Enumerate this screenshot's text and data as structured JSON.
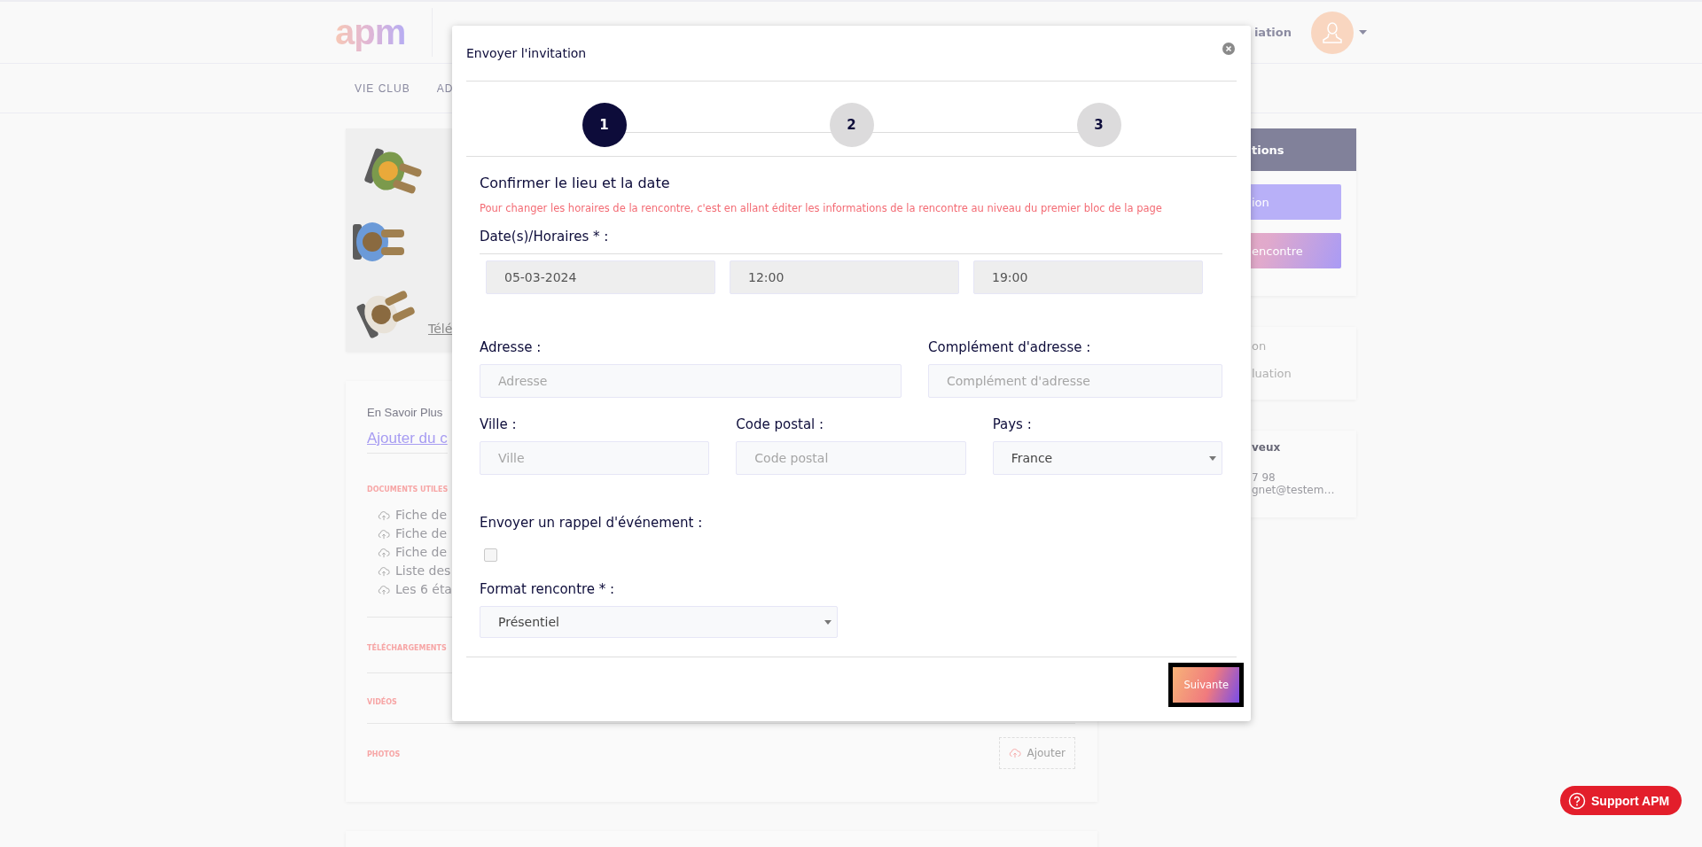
{
  "header": {
    "logo": "apm",
    "nav_fragment": "iation"
  },
  "nav": {
    "items": [
      {
        "label": "VIE CLUB"
      },
      {
        "label": "AD"
      }
    ]
  },
  "left": {
    "media_card": {
      "link": "Télé"
    },
    "info_card": {
      "heading": "En Savoir Plus",
      "add_link": "Ajouter du c",
      "documents_label": "DOCUMENTS UTILES",
      "documents": [
        {
          "label": "Fiche de"
        },
        {
          "label": "Fiche de"
        },
        {
          "label": "Fiche de"
        },
        {
          "label": "Liste des"
        },
        {
          "label": "Les 6 éta"
        }
      ],
      "downloads_label": "TÉLÉCHARGEMENTS",
      "videos_label": "VIDÉOS",
      "photos_label": "PHOTOS",
      "add_button": "Ajouter"
    }
  },
  "right": {
    "actions_card": {
      "title": "tions",
      "buttons": [
        {
          "label": "ion",
          "kind": "plain"
        },
        {
          "label": "encontre",
          "kind": "gradient"
        }
      ]
    },
    "links_card": {
      "items": [
        "on",
        "luation"
      ]
    },
    "contact_card": {
      "name": "veux",
      "phone": "7 98",
      "email": "gnet@testem…"
    }
  },
  "modal": {
    "title": "Envoyer l'invitation",
    "steps": [
      {
        "label": "1",
        "selected": true
      },
      {
        "label": "2",
        "selected": false
      },
      {
        "label": "3",
        "selected": false
      }
    ],
    "section_title": "Confirmer le lieu et la date",
    "note": "Pour changer les horaires de la rencontre, c'est en allant éditer les informations de la rencontre au niveau du premier bloc de la page",
    "schedule": {
      "label": "Date(s)/Horaires * :",
      "fields": [
        {
          "value": "05-03-2024",
          "disabled": true
        },
        {
          "value": "12:00",
          "disabled": true
        },
        {
          "value": "19:00",
          "disabled": true
        }
      ]
    },
    "address_rows": [
      {
        "fields": [
          {
            "label": "Adresse :",
            "kind": "input",
            "placeholder": "Adresse"
          },
          {
            "label": "Complément d'adresse :",
            "kind": "input",
            "placeholder": "Complément d'adresse"
          }
        ]
      },
      {
        "fields": [
          {
            "label": "Ville :",
            "kind": "input",
            "placeholder": "Ville"
          },
          {
            "label": "Code postal :",
            "kind": "input",
            "placeholder": "Code postal"
          },
          {
            "label": "Pays :",
            "kind": "select",
            "value": "France"
          }
        ]
      }
    ],
    "reminder": {
      "label": "Envoyer un rappel d'événement :",
      "checked": false
    },
    "format": {
      "label": "Format rencontre * :",
      "value": "Présentiel"
    },
    "next_button": "Suivante"
  },
  "support_button": "Support APM"
}
